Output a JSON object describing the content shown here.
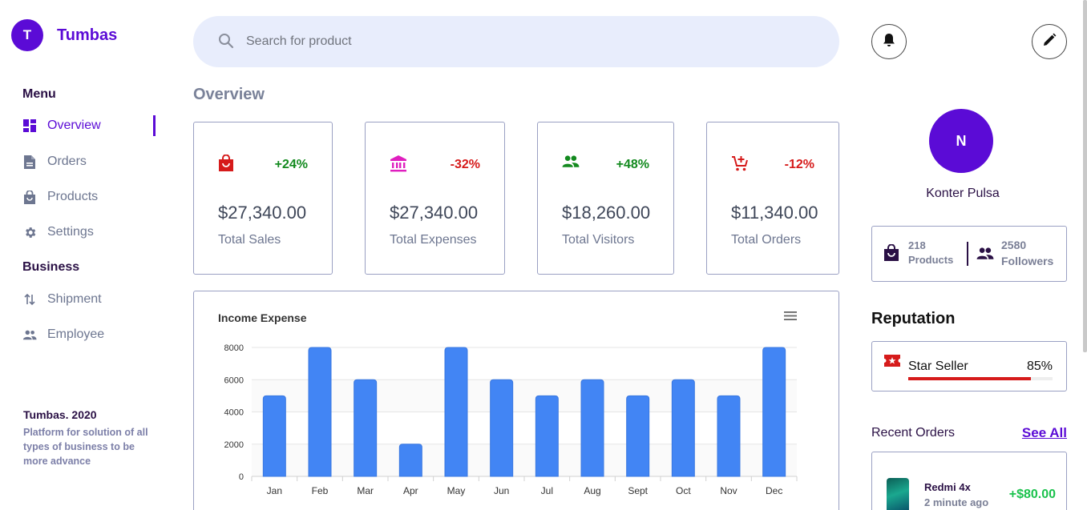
{
  "brand": {
    "initial": "T",
    "name": "Tumbas"
  },
  "sidebar": {
    "menu_heading": "Menu",
    "menu_items": [
      {
        "label": "Overview",
        "icon": "dashboard-icon",
        "active": true
      },
      {
        "label": "Orders",
        "icon": "document-icon"
      },
      {
        "label": "Products",
        "icon": "shopping-bag-icon"
      },
      {
        "label": "Settings",
        "icon": "gear-icon"
      }
    ],
    "business_heading": "Business",
    "business_items": [
      {
        "label": "Shipment",
        "icon": "swap-vertical-icon"
      },
      {
        "label": "Employee",
        "icon": "people-icon"
      }
    ],
    "footer_title": "Tumbas. 2020",
    "footer_desc": "Platform for solution of all types of business to be more advance"
  },
  "search": {
    "placeholder": "Search for product"
  },
  "overview_title": "Overview",
  "cards": [
    {
      "icon": "shopping-bag-icon",
      "change": "+24%",
      "value": "$27,340.00",
      "label": "Total Sales"
    },
    {
      "icon": "bank-icon",
      "change": "-32%",
      "value": "$27,340.00",
      "label": "Total Expenses"
    },
    {
      "icon": "people-icon",
      "change": "+48%",
      "value": "$18,260.00",
      "label": "Total Visitors"
    },
    {
      "icon": "cart-add-icon",
      "change": "-12%",
      "value": "$11,340.00",
      "label": "Total Orders"
    }
  ],
  "colors": {
    "primary": "#5b0bd6",
    "positive": "#138a1f",
    "negative": "#d61b1b",
    "bar": "#4285f4",
    "search_bg": "#e8edfc"
  },
  "chart_data": {
    "type": "bar",
    "title": "Income Expense",
    "categories": [
      "Jan",
      "Feb",
      "Mar",
      "Apr",
      "May",
      "Jun",
      "Jul",
      "Aug",
      "Sept",
      "Oct",
      "Nov",
      "Dec"
    ],
    "values": [
      5000,
      8000,
      6000,
      2000,
      8000,
      6000,
      5000,
      6000,
      5000,
      6000,
      5000,
      8000
    ],
    "ylim": [
      0,
      8000
    ],
    "yticks": [
      0,
      2000,
      4000,
      6000,
      8000
    ],
    "grid": true,
    "legend": "none"
  },
  "profile": {
    "initial": "N",
    "name": "Konter Pulsa",
    "products_count": "218",
    "products_label": "Products",
    "followers_count": "2580",
    "followers_label": "Followers"
  },
  "reputation": {
    "title": "Reputation",
    "label": "Star Seller",
    "percent_text": "85%",
    "percent": 85
  },
  "recent_orders": {
    "title": "Recent Orders",
    "see_all": "See All",
    "items": [
      {
        "name": "Redmi 4x",
        "time": "2 minute ago",
        "price": "+$80.00"
      }
    ]
  }
}
